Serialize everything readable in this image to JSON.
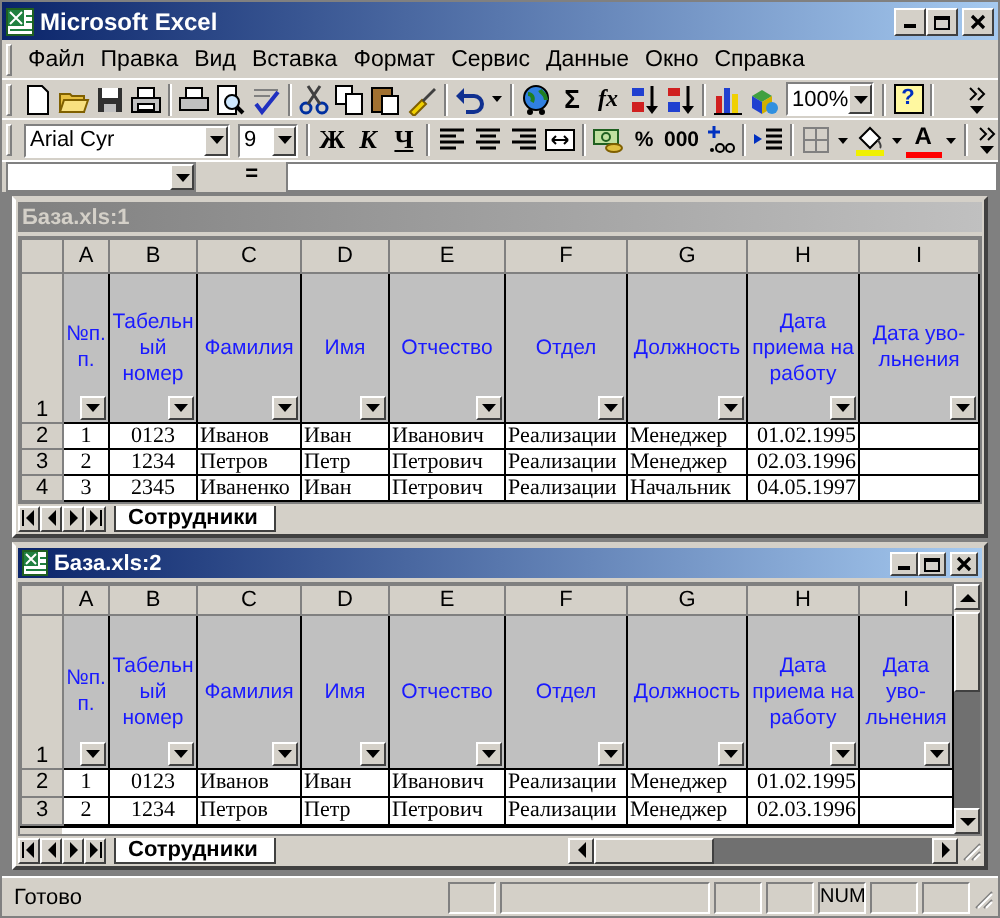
{
  "window": {
    "title": "Microsoft Excel"
  },
  "menu": [
    {
      "label": "Файл"
    },
    {
      "label": "Правка"
    },
    {
      "label": "Вид"
    },
    {
      "label": "Вставка"
    },
    {
      "label": "Формат"
    },
    {
      "label": "Сервис"
    },
    {
      "label": "Данные"
    },
    {
      "label": "Окно"
    },
    {
      "label": "Справка"
    }
  ],
  "standard_toolbar": [
    [
      {
        "kind": "icon"
      },
      {
        "kind": "icon"
      },
      {
        "kind": "icon"
      },
      {
        "kind": "icon"
      }
    ],
    [
      {
        "kind": "icon"
      },
      {
        "kind": "icon"
      },
      {
        "kind": "icon"
      }
    ],
    [
      {
        "kind": "icon"
      },
      {
        "kind": "icon"
      },
      {
        "kind": "icon"
      },
      {
        "kind": "icon"
      }
    ],
    [
      {
        "kind": "icon"
      },
      {
        "kind": "caret"
      }
    ],
    [
      {
        "kind": "icon"
      },
      {
        "kind": "glyph",
        "text": "Σ"
      },
      {
        "kind": "glyph",
        "text": "fx"
      },
      {
        "kind": "icon"
      },
      {
        "kind": "icon"
      }
    ],
    [
      {
        "kind": "icon"
      },
      {
        "kind": "icon"
      },
      {
        "kind": "combo",
        "value": "100%"
      }
    ],
    [
      {
        "kind": "help",
        "text": "?"
      }
    ],
    [
      {
        "kind": "icon"
      }
    ]
  ],
  "formatting_toolbar": [
    [
      {
        "kind": "combo",
        "value": "Arial Cyr"
      },
      {
        "kind": "combo",
        "value": "9"
      }
    ],
    [
      {
        "kind": "glyph",
        "text": "Ж"
      },
      {
        "kind": "glyph",
        "text": "К"
      },
      {
        "kind": "glyph",
        "text": "Ч"
      }
    ],
    [
      {
        "kind": "icon"
      },
      {
        "kind": "icon"
      },
      {
        "kind": "icon"
      },
      {
        "kind": "icon"
      }
    ],
    [
      {
        "kind": "icon"
      },
      {
        "kind": "glyph",
        "text": "%"
      },
      {
        "kind": "glyph",
        "text": "000"
      },
      {
        "kind": "icon"
      }
    ],
    [
      {
        "kind": "icon"
      }
    ],
    [
      {
        "kind": "icon"
      },
      {
        "kind": "caret"
      },
      {
        "kind": "icon"
      },
      {
        "kind": "caret"
      },
      {
        "kind": "font_color",
        "text": "A"
      },
      {
        "kind": "caret"
      }
    ],
    [
      {
        "kind": "icon"
      }
    ]
  ],
  "formula_bar": {
    "equals": "="
  },
  "workbook_windows": [
    {
      "title": "База.xls:1",
      "active": false,
      "scrollbars": false,
      "columns": [
        "A",
        "B",
        "C",
        "D",
        "E",
        "F",
        "G",
        "H",
        "I"
      ],
      "header_row": {
        "number": "1",
        "cells": [
          "№п.\nп.",
          "Табельн\nый\nномер",
          "Фамилия",
          "Имя",
          "Отчество",
          "Отдел",
          "Должность",
          "Дата\nприема на\nработу",
          "Дата уво-\nльнения"
        ]
      },
      "rows": [
        {
          "number": "2",
          "cells": [
            "1",
            "0123",
            "Иванов",
            "Иван",
            "Иванович",
            "Реализации",
            "Менеджер",
            "01.02.1995"
          ]
        },
        {
          "number": "3",
          "cells": [
            "2",
            "1234",
            "Петров",
            "Петр",
            "Петрович",
            "Реализации",
            "Менеджер",
            "02.03.1996"
          ]
        },
        {
          "number": "4",
          "cells": [
            "3",
            "2345",
            "Иваненко",
            "Иван",
            "Петрович",
            "Реализации",
            "Начальник",
            "04.05.1997"
          ]
        }
      ],
      "sheet_tabs": [
        {
          "label": "Сотрудники",
          "selected": true
        }
      ]
    },
    {
      "title": "База.xls:2",
      "active": true,
      "scrollbars": true,
      "columns": [
        "A",
        "B",
        "C",
        "D",
        "E",
        "F",
        "G",
        "H",
        "I"
      ],
      "header_row": {
        "number": "1",
        "cells": [
          "№п.\nп.",
          "Табельн\nый\nномер",
          "Фамилия",
          "Имя",
          "Отчество",
          "Отдел",
          "Должность",
          "Дата\nприема на\nработу",
          "Дата уво-\nльнения"
        ]
      },
      "rows": [
        {
          "number": "2",
          "cells": [
            "1",
            "0123",
            "Иванов",
            "Иван",
            "Иванович",
            "Реализации",
            "Менеджер",
            "01.02.1995"
          ]
        },
        {
          "number": "3",
          "cells": [
            "2",
            "1234",
            "Петров",
            "Петр",
            "Петрович",
            "Реализации",
            "Менеджер",
            "02.03.1996"
          ]
        }
      ],
      "sheet_tabs": [
        {
          "label": "Сотрудники",
          "selected": true
        }
      ]
    }
  ],
  "status_bar": {
    "text": "Готово",
    "num_lock": "NUM"
  }
}
